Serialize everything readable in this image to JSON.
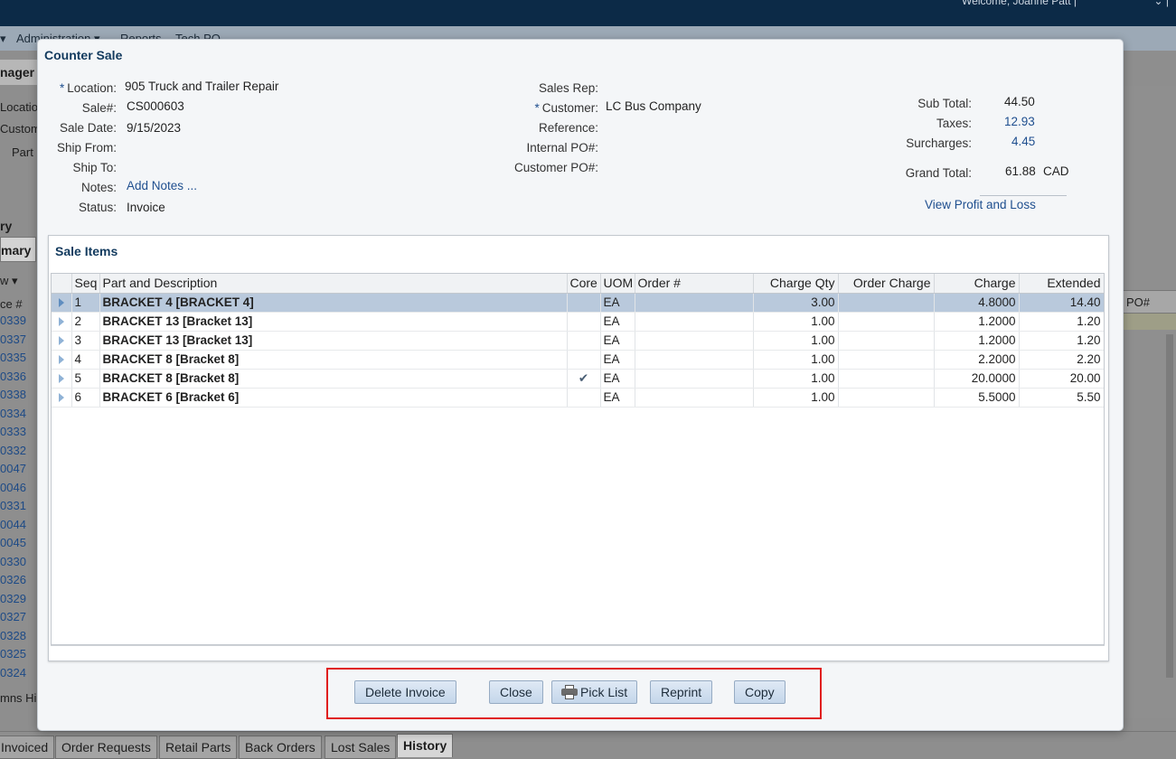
{
  "background": {
    "welcome": "Welcome, Joanne Patt |",
    "menu": [
      "Administration ▾",
      "Reports",
      "Tech PO"
    ],
    "header": "nager",
    "fields": [
      "Locatio",
      "Custome",
      "Part"
    ],
    "tabs": [
      "ry",
      "mary"
    ],
    "view": "w ▾",
    "col_header": "ce #",
    "list": [
      "0339",
      "0337",
      "0335",
      "0336",
      "0338",
      "0334",
      "0333",
      "0332",
      "0047",
      "0046",
      "0331",
      "0044",
      "0045",
      "0330",
      "0326",
      "0329",
      "0327",
      "0328",
      "0325",
      "0324"
    ],
    "right_col": "PO#",
    "columns_hint": "mns Hi",
    "bottom_tabs": [
      "Invoiced",
      "Order Requests",
      "Retail Parts",
      "Back Orders",
      "Lost Sales",
      "History"
    ]
  },
  "modal": {
    "title": "Counter Sale",
    "left_fields": {
      "location_label": "Location:",
      "location": "905 Truck and Trailer Repair",
      "sale_no_label": "Sale#:",
      "sale_no": "CS000603",
      "sale_date_label": "Sale Date:",
      "sale_date": "9/15/2023",
      "ship_from_label": "Ship From:",
      "ship_to_label": "Ship To:",
      "notes_label": "Notes:",
      "notes_link": "Add Notes ...",
      "status_label": "Status:",
      "status": "Invoice"
    },
    "mid_fields": {
      "sales_rep_label": "Sales Rep:",
      "customer_label": "Customer:",
      "customer": "LC Bus Company",
      "reference_label": "Reference:",
      "internal_po_label": "Internal PO#:",
      "customer_po_label": "Customer PO#:"
    },
    "totals": {
      "sub_total_label": "Sub Total:",
      "sub_total": "44.50",
      "taxes_label": "Taxes:",
      "taxes": "12.93",
      "surcharges_label": "Surcharges:",
      "surcharges": "4.45",
      "grand_total_label": "Grand Total:",
      "grand_total": "61.88",
      "currency": "CAD",
      "profit_loss_link": "View Profit and Loss"
    },
    "sale_items": {
      "title": "Sale Items",
      "columns": [
        "Seq",
        "Part and Description",
        "Core",
        "UOM",
        "Order #",
        "Charge Qty",
        "Order Charge",
        "Charge",
        "Extended"
      ],
      "rows": [
        {
          "seq": "1",
          "part": "BRACKET 4 [BRACKET 4]",
          "core": "",
          "uom": "EA",
          "order_no": "",
          "charge_qty": "3.00",
          "order_charge": "",
          "charge": "4.8000",
          "extended": "14.40"
        },
        {
          "seq": "2",
          "part": "BRACKET 13 [Bracket 13]",
          "core": "",
          "uom": "EA",
          "order_no": "",
          "charge_qty": "1.00",
          "order_charge": "",
          "charge": "1.2000",
          "extended": "1.20"
        },
        {
          "seq": "3",
          "part": "BRACKET 13 [Bracket 13]",
          "core": "",
          "uom": "EA",
          "order_no": "",
          "charge_qty": "1.00",
          "order_charge": "",
          "charge": "1.2000",
          "extended": "1.20"
        },
        {
          "seq": "4",
          "part": "BRACKET 8 [Bracket 8]",
          "core": "",
          "uom": "EA",
          "order_no": "",
          "charge_qty": "1.00",
          "order_charge": "",
          "charge": "2.2000",
          "extended": "2.20"
        },
        {
          "seq": "5",
          "part": "BRACKET 8 [Bracket 8]",
          "core": "✔",
          "uom": "EA",
          "order_no": "",
          "charge_qty": "1.00",
          "order_charge": "",
          "charge": "20.0000",
          "extended": "20.00"
        },
        {
          "seq": "6",
          "part": "BRACKET 6 [Bracket 6]",
          "core": "",
          "uom": "EA",
          "order_no": "",
          "charge_qty": "1.00",
          "order_charge": "",
          "charge": "5.5000",
          "extended": "5.50"
        }
      ]
    },
    "buttons": {
      "delete_invoice": "Delete Invoice",
      "close": "Close",
      "pick_list": "Pick List",
      "reprint": "Reprint",
      "copy": "Copy"
    }
  }
}
